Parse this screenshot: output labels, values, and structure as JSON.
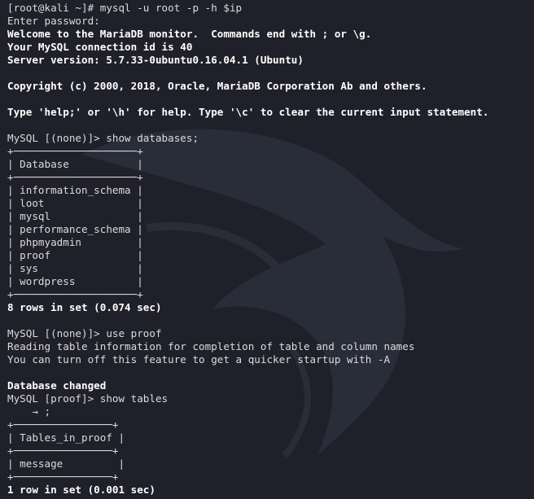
{
  "terminal": {
    "background": "#1f2029",
    "text_color": "#dcdcdc",
    "lines": [
      {
        "text": "[root@kali ~]# mysql -u root -p -h $ip",
        "style": "normal"
      },
      {
        "text": "Enter password:",
        "style": "normal"
      },
      {
        "text": "Welcome to the MariaDB monitor.  Commands end with ; or \\g.",
        "style": "bold"
      },
      {
        "text": "Your MySQL connection id is 40",
        "style": "bold"
      },
      {
        "text": "Server version: 5.7.33-0ubuntu0.16.04.1 (Ubuntu)",
        "style": "bold"
      },
      {
        "text": "",
        "style": "blank"
      },
      {
        "text": "Copyright (c) 2000, 2018, Oracle, MariaDB Corporation Ab and others.",
        "style": "bold"
      },
      {
        "text": "",
        "style": "blank"
      },
      {
        "text": "Type 'help;' or '\\h' for help. Type '\\c' to clear the current input statement.",
        "style": "bold"
      },
      {
        "text": "",
        "style": "blank"
      },
      {
        "text": "MySQL [(none)]> show databases;",
        "style": "normal"
      },
      {
        "text": "+────────────────────+",
        "style": "normal"
      },
      {
        "text": "| Database           |",
        "style": "normal"
      },
      {
        "text": "+────────────────────+",
        "style": "normal"
      },
      {
        "text": "| information_schema |",
        "style": "normal"
      },
      {
        "text": "| loot               |",
        "style": "normal"
      },
      {
        "text": "| mysql              |",
        "style": "normal"
      },
      {
        "text": "| performance_schema |",
        "style": "normal"
      },
      {
        "text": "| phpmyadmin         |",
        "style": "normal"
      },
      {
        "text": "| proof              |",
        "style": "normal"
      },
      {
        "text": "| sys                |",
        "style": "normal"
      },
      {
        "text": "| wordpress          |",
        "style": "normal"
      },
      {
        "text": "+────────────────────+",
        "style": "normal"
      },
      {
        "text": "8 rows in set (0.074 sec)",
        "style": "bold"
      },
      {
        "text": "",
        "style": "blank"
      },
      {
        "text": "MySQL [(none)]> use proof",
        "style": "normal"
      },
      {
        "text": "Reading table information for completion of table and column names",
        "style": "normal"
      },
      {
        "text": "You can turn off this feature to get a quicker startup with -A",
        "style": "normal"
      },
      {
        "text": "",
        "style": "blank"
      },
      {
        "text": "Database changed",
        "style": "bold"
      },
      {
        "text": "MySQL [proof]> show tables",
        "style": "normal"
      },
      {
        "text": "    → ;",
        "style": "normal"
      },
      {
        "text": "+────────────────+",
        "style": "normal"
      },
      {
        "text": "| Tables_in_proof |",
        "style": "normal"
      },
      {
        "text": "+────────────────+",
        "style": "normal"
      },
      {
        "text": "| message         |",
        "style": "normal"
      },
      {
        "text": "+────────────────+",
        "style": "normal"
      },
      {
        "text": "1 row in set (0.001 sec)",
        "style": "bold"
      }
    ]
  },
  "icons": {
    "watermark": "kali-dragon-icon"
  }
}
